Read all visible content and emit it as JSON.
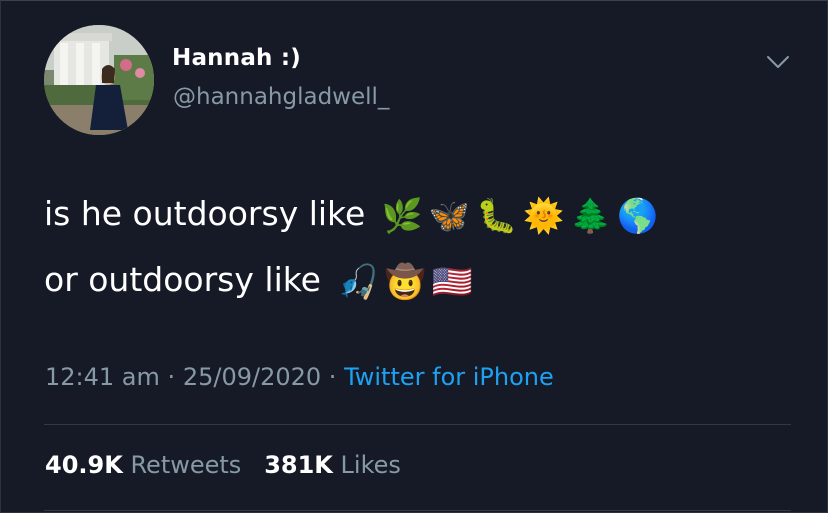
{
  "tweet": {
    "author_name": "Hannah :)",
    "author_handle": "@hannahgladwell_",
    "line1_text": "is he outdoorsy like",
    "line1_emojis": [
      "🌿",
      "🦋",
      "🐛",
      "🌞",
      "🌲",
      "🌎"
    ],
    "line2_text": "or outdoorsy like",
    "line2_emojis": [
      "🎣",
      "🤠",
      "🇺🇸"
    ],
    "time": "12:41 am",
    "separator": "·",
    "date": "25/09/2020",
    "source": "Twitter for iPhone",
    "retweets_count": "40.9K",
    "retweets_label": "Retweets",
    "likes_count": "381K",
    "likes_label": "Likes"
  },
  "icons": {
    "menu": "chevron-down-icon",
    "avatar": "profile-photo"
  },
  "colors": {
    "background": "#151a26",
    "primary_text": "#ffffff",
    "secondary_text": "#8899a6",
    "link": "#1da1f2",
    "divider": "#2f3a46"
  }
}
